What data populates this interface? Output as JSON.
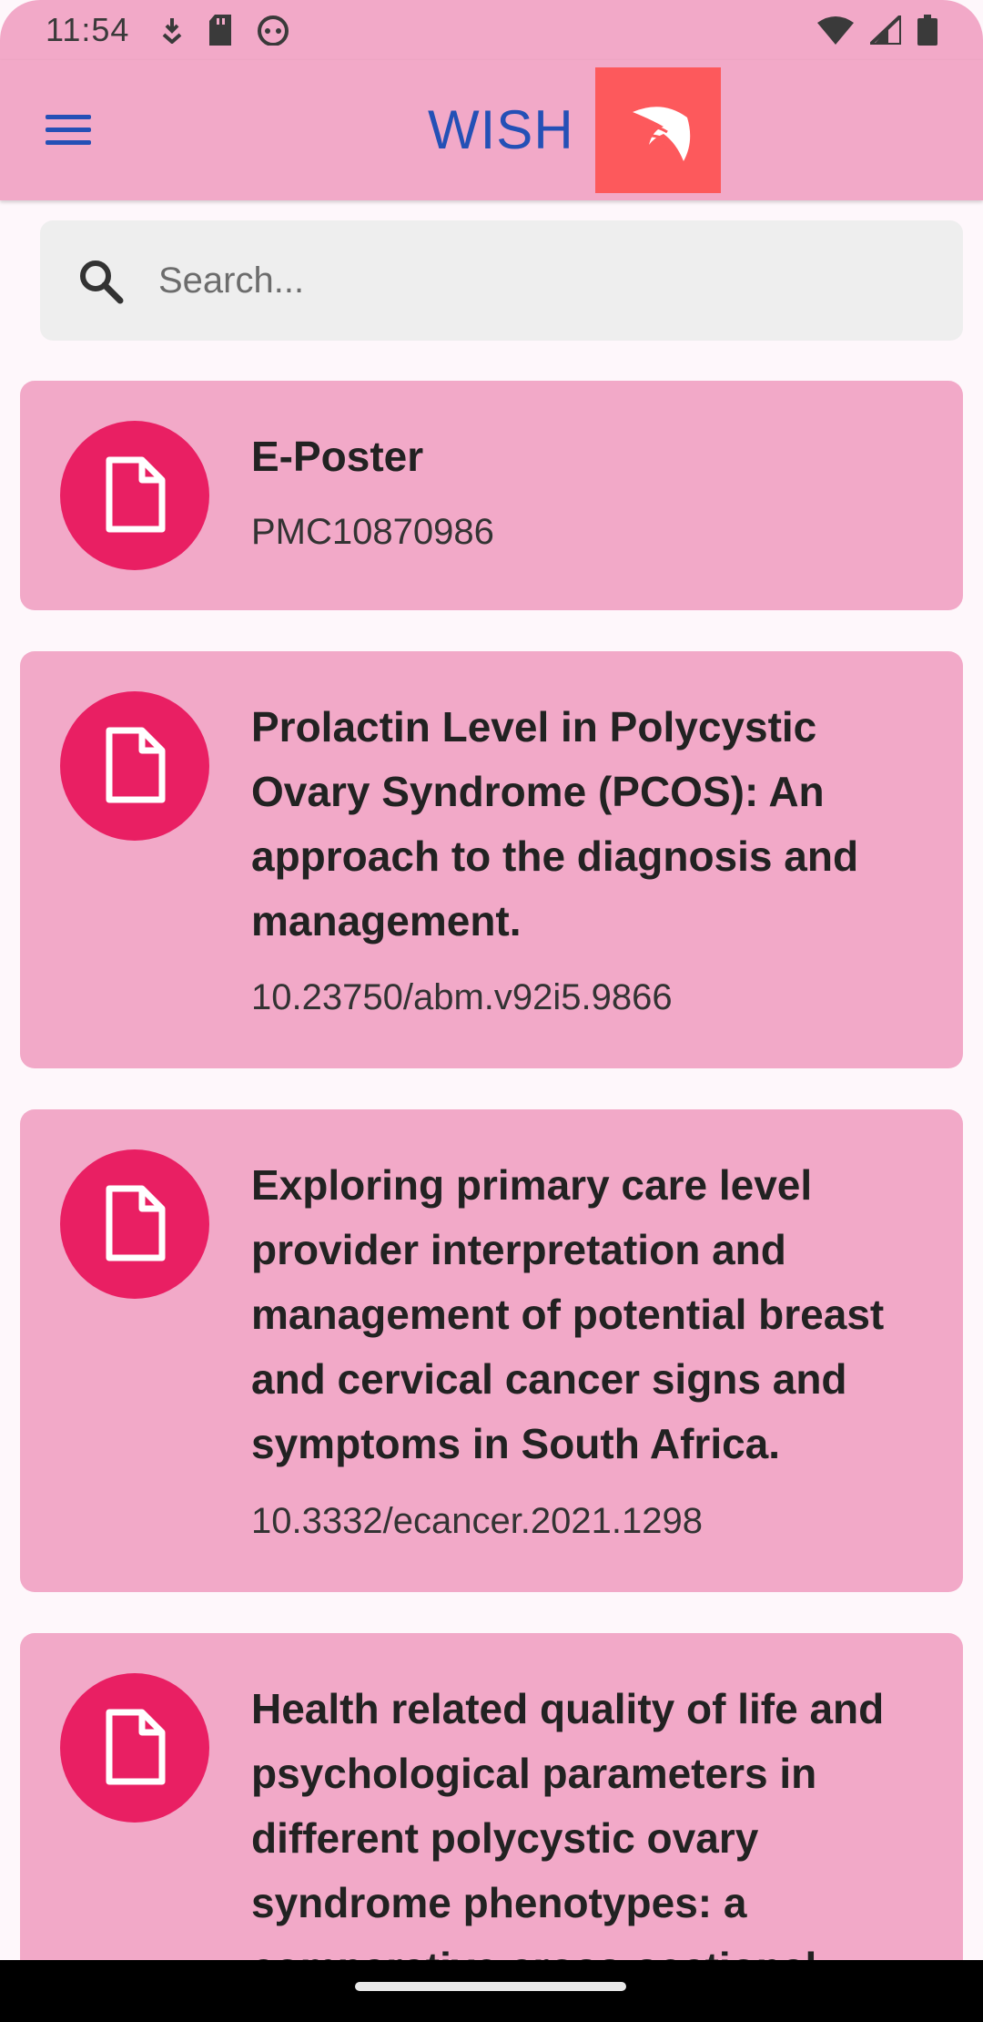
{
  "status_bar": {
    "time": "11:54",
    "left_icons": [
      "download-arrow-icon",
      "sd-card-icon",
      "android-icon"
    ],
    "right_icons": [
      "wifi-icon",
      "signal-icon",
      "battery-icon"
    ]
  },
  "app_bar": {
    "title": "WISH",
    "menu_icon": "hamburger-menu-icon",
    "logo_icon": "wing-logo-icon"
  },
  "search": {
    "placeholder": "Search..."
  },
  "cards": [
    {
      "title": "E-Poster",
      "subtitle": "PMC10870986",
      "icon": "document-icon"
    },
    {
      "title": "Prolactin Level in Polycystic Ovary Syndrome (PCOS): An approach to the diagnosis and management.",
      "subtitle": "10.23750/abm.v92i5.9866",
      "icon": "document-icon"
    },
    {
      "title": "Exploring primary care level provider interpretation and management of potential breast and cervical cancer signs and symptoms in South Africa.",
      "subtitle": "10.3332/ecancer.2021.1298",
      "icon": "document-icon"
    },
    {
      "title": "Health related quality of life and psychological parameters in different polycystic ovary syndrome phenotypes: a comparative cross-sectional",
      "subtitle": "",
      "icon": "document-icon"
    }
  ],
  "colors": {
    "app_bar": "#f2a9c8",
    "card": "#f2a9c8",
    "icon_circle": "#e91f63",
    "title_blue": "#2450b6",
    "logo_bg": "#fd595c"
  }
}
